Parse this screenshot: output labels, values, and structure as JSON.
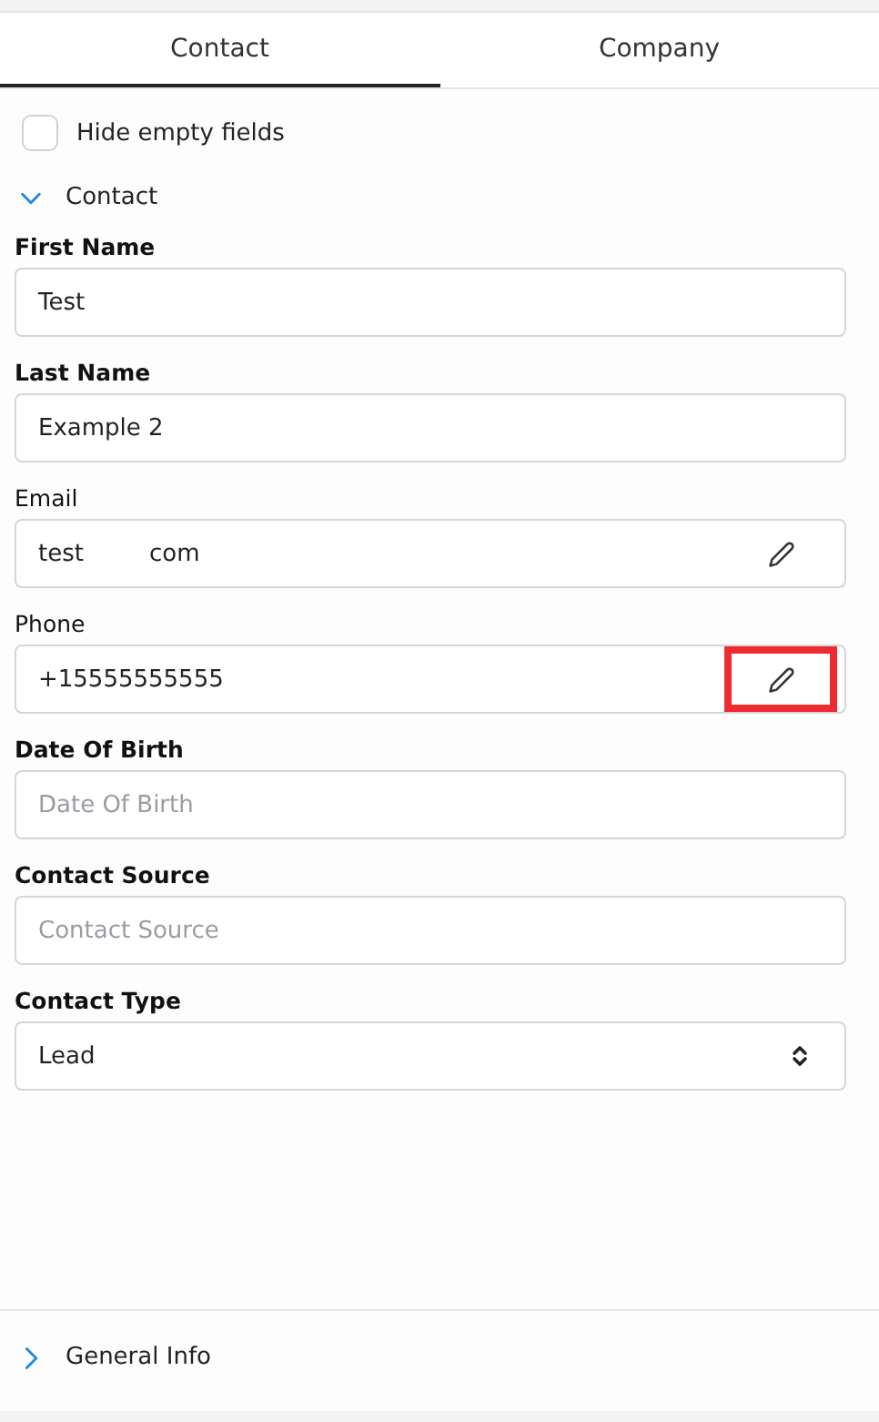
{
  "tabs": [
    {
      "label": "Contact",
      "selected": true
    },
    {
      "label": "Company",
      "selected": false
    }
  ],
  "hide_empty": {
    "label": "Hide empty fields",
    "checked": false
  },
  "sections": [
    {
      "title": "Contact",
      "expanded": true,
      "fields": [
        {
          "kind": "text",
          "label": "First Name",
          "value": "Test"
        },
        {
          "kind": "text",
          "label": "Last Name",
          "value": "Example 2"
        },
        {
          "kind": "editable",
          "label": "Email",
          "value_parts": [
            "test",
            "com"
          ],
          "highlighted": false
        },
        {
          "kind": "editable",
          "label": "Phone",
          "value_parts": [
            "+15555555555"
          ],
          "highlighted": true
        },
        {
          "kind": "text",
          "label": "Date Of Birth",
          "placeholder": "Date Of Birth"
        },
        {
          "kind": "text",
          "label": "Contact Source",
          "placeholder": "Contact Source"
        },
        {
          "kind": "select",
          "label": "Contact Type",
          "value": "Lead"
        }
      ]
    },
    {
      "title": "General Info",
      "expanded": false
    }
  ]
}
